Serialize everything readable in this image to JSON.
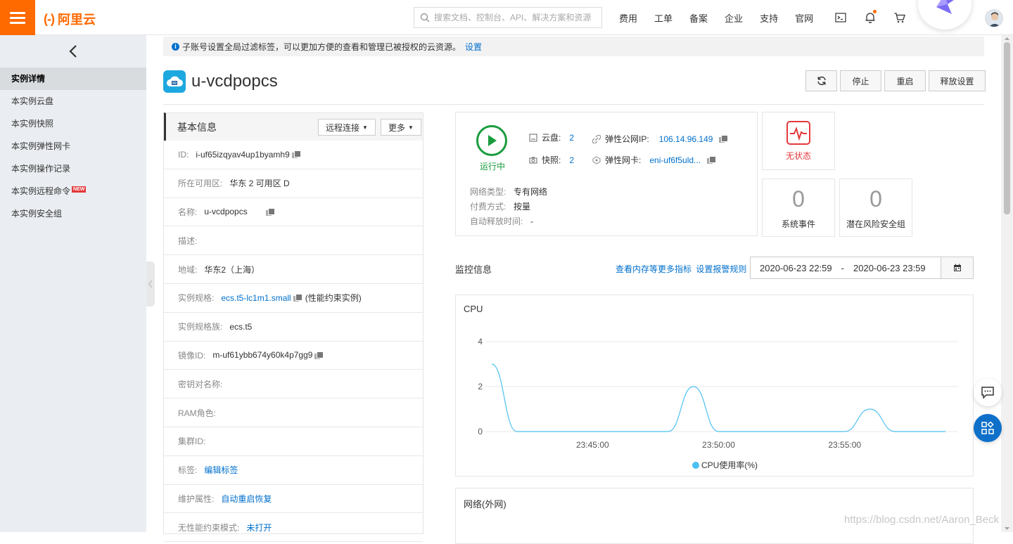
{
  "topbar": {
    "brand": "阿里云",
    "search_placeholder": "搜索文档、控制台、API、解决方案和资源",
    "nav": [
      "费用",
      "工单",
      "备案",
      "企业",
      "支持",
      "官网"
    ]
  },
  "sidebar": {
    "items": [
      {
        "label": "实例详情",
        "active": true
      },
      {
        "label": "本实例云盘"
      },
      {
        "label": "本实例快照"
      },
      {
        "label": "本实例弹性网卡"
      },
      {
        "label": "本实例操作记录"
      },
      {
        "label": "本实例远程命令",
        "badge": "NEW"
      },
      {
        "label": "本实例安全组"
      }
    ]
  },
  "notice": {
    "text": "子账号设置全局过滤标签，可以更加方便的查看和管理已被授权的云资源。",
    "link": "设置"
  },
  "instance": {
    "name": "u-vcdpopcs"
  },
  "actions": {
    "stop": "停止",
    "restart": "重启",
    "release": "释放设置"
  },
  "basic": {
    "title": "基本信息",
    "remote_btn": "远程连接",
    "more_btn": "更多",
    "rows": [
      {
        "k": "ID:",
        "v": "i-uf65izqyav4up1byamh9",
        "copy": true
      },
      {
        "k": "所在可用区:",
        "v": "华东 2 可用区 D"
      },
      {
        "k": "名称:",
        "v": "u-vcdpopcs",
        "copy": true
      },
      {
        "k": "描述:",
        "v": ""
      },
      {
        "k": "地域:",
        "v": "华东2（上海）"
      },
      {
        "k": "实例规格:",
        "v": "ecs.t5-lc1m1.small",
        "link": true,
        "copy": true,
        "suffix": "(性能约束实例)"
      },
      {
        "k": "实例规格族:",
        "v": "ecs.t5"
      },
      {
        "k": "镜像ID:",
        "v": "m-uf61ybb674y60k4p7gg9",
        "copy": true
      },
      {
        "k": "密钥对名称:",
        "v": ""
      },
      {
        "k": "RAM角色:",
        "v": ""
      },
      {
        "k": "集群ID:",
        "v": ""
      },
      {
        "k": "标签:",
        "v": "编辑标签",
        "link": true
      },
      {
        "k": "维护属性:",
        "v": "自动重启恢复",
        "link": true
      },
      {
        "k": "无性能约束模式:",
        "v": "未打开",
        "link": true
      }
    ]
  },
  "status": {
    "running": "运行中",
    "disk_label": "云盘:",
    "disk_count": "2",
    "snap_label": "快照:",
    "snap_count": "2",
    "eip_label": "弹性公网IP:",
    "eip": "106.14.96.149",
    "eni_label": "弹性网卡:",
    "eni": "eni-uf6f5uld...",
    "net_type_k": "网络类型:",
    "net_type_v": "专有网络",
    "pay_k": "付费方式:",
    "pay_v": "按量",
    "release_k": "自动释放时间:",
    "release_v": "-"
  },
  "side_cards": {
    "health": "无状态",
    "sys_events_count": "0",
    "sys_events_label": "系统事件",
    "risk_count": "0",
    "risk_label": "潜在风险安全组"
  },
  "monitor": {
    "title": "监控信息",
    "link1": "查看内存等更多指标",
    "link2": "设置报警规则",
    "date_from": "2020-06-23 22:59",
    "date_sep": "-",
    "date_to": "2020-06-23 23:59"
  },
  "chart_data": {
    "type": "line",
    "title": "CPU",
    "ylim": [
      0,
      4
    ],
    "yticks": [
      "4",
      "2",
      "0"
    ],
    "xticks": [
      "23:45:00",
      "23:50:00",
      "23:55:00"
    ],
    "series": [
      {
        "name": "CPU使用率(%)",
        "color": "#4cc0f0",
        "x": [
          "23:41:00",
          "23:42:00",
          "23:43:00",
          "23:48:00",
          "23:49:00",
          "23:50:00",
          "23:54:00",
          "23:55:00",
          "23:56:00",
          "23:57:00",
          "23:59:00"
        ],
        "values": [
          3,
          0,
          0,
          0,
          2,
          0,
          0,
          0,
          1,
          0,
          0
        ]
      }
    ],
    "grid": true,
    "legend": "bottom"
  },
  "network_box": {
    "title": "网络(外网)"
  },
  "watermark": "https://blog.csdn.net/Aaron_Beck"
}
